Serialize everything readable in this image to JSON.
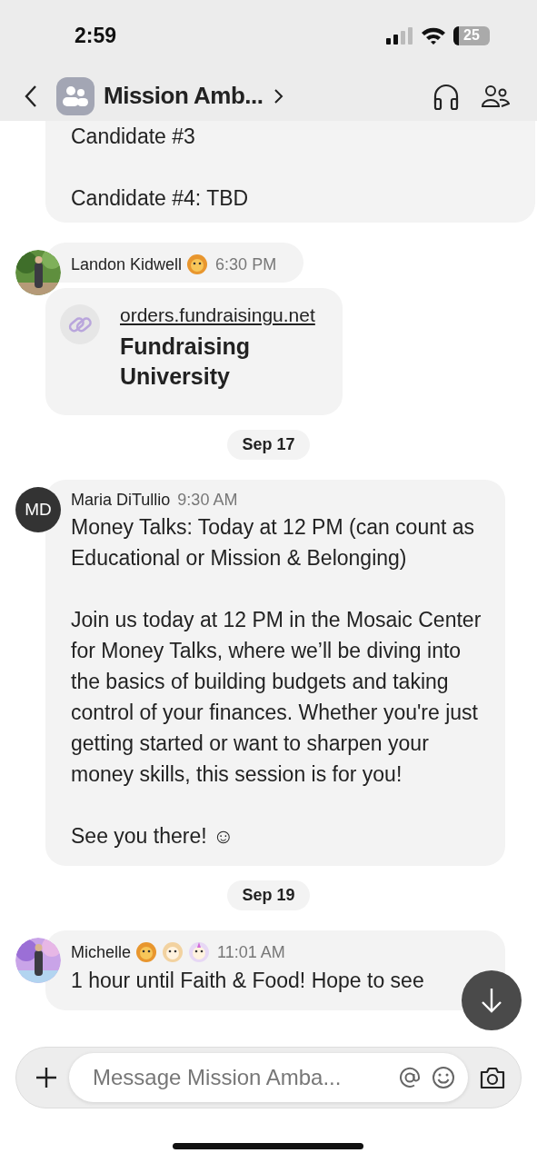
{
  "status_bar": {
    "time": "2:59",
    "battery": "25"
  },
  "header": {
    "title": "Mission Amb..."
  },
  "messages": [
    {
      "kind": "continuation",
      "text": "Candidate #3\n\nCandidate #4: TBD"
    },
    {
      "kind": "link",
      "sender": "Landon Kidwell",
      "emoji_icons": [
        {
          "kind": "lion"
        }
      ],
      "time": "6:30 PM",
      "url": "orders.fundraisingu.net",
      "link_title": "Fundraising University"
    },
    {
      "kind": "date",
      "text": "Sep 17"
    },
    {
      "kind": "text",
      "sender": "Maria DiTullio",
      "time": "9:30 AM",
      "avatar": {
        "kind": "initials",
        "text": "MD"
      },
      "text": "Money Talks: Today at 12 PM (can count as Educational or Mission & Belonging)\n\nJoin us today at 12 PM in the Mosaic Center for Money Talks, where we’ll be diving into the basics of building budgets and taking control of your finances. Whether you're just getting started or want to sharpen your money skills, this session is for you!\n\nSee you there! ☺"
    },
    {
      "kind": "date",
      "text": "Sep 19"
    },
    {
      "kind": "text",
      "sender": "Michelle",
      "emoji_icons": [
        {
          "kind": "lion"
        },
        {
          "kind": "dog"
        },
        {
          "kind": "unicorn"
        }
      ],
      "time": "11:01 AM",
      "text": "1 hour until Faith & Food! Hope to see"
    }
  ],
  "composer": {
    "placeholder": "Message Mission Amba..."
  }
}
